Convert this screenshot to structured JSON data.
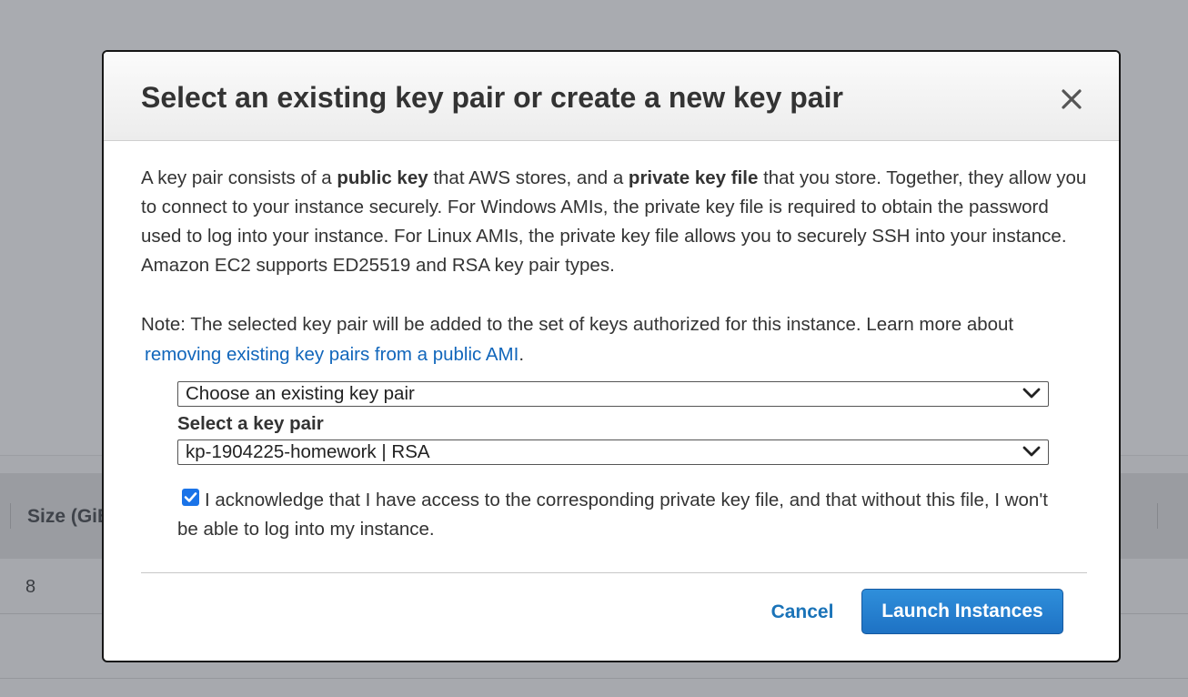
{
  "background": {
    "column_header": "Size (GiB)",
    "row_cell": "8"
  },
  "modal": {
    "title": "Select an existing key pair or create a new key pair",
    "description": {
      "part1": "A key pair consists of a ",
      "bold1": "public key",
      "part2": " that AWS stores, and a ",
      "bold2": "private key file",
      "part3": " that you store. Together, they allow you to connect to your instance securely. For Windows AMIs, the private key file is required to obtain the password used to log into your instance. For Linux AMIs, the private key file allows you to securely SSH into your instance. Amazon EC2 supports ED25519 and RSA key pair types."
    },
    "note": {
      "text": "Note: The selected key pair will be added to the set of keys authorized for this instance. Learn more about",
      "link": "removing existing key pairs from a public AMI",
      "period": "."
    },
    "key_pair_mode": {
      "selected": "Choose an existing key pair"
    },
    "select_label": "Select a key pair",
    "key_pair": {
      "selected": "kp-1904225-homework | RSA"
    },
    "acknowledge": {
      "checked": true,
      "text": "I acknowledge that I have access to the corresponding private key file, and that without this file, I won't be able to log into my instance."
    },
    "cancel_label": "Cancel",
    "launch_label": "Launch Instances"
  },
  "colors": {
    "primary_button": "#1e72c4",
    "link": "#1166bb",
    "overlay": "#a7a9ae"
  },
  "icons": {
    "close": "close-icon",
    "chevron": "chevron-down-icon",
    "check": "checkmark-icon"
  }
}
